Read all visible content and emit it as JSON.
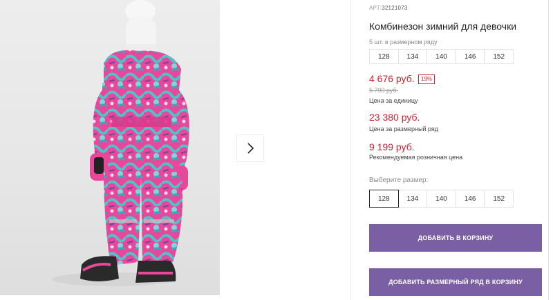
{
  "product": {
    "article_prefix": "АРТ:",
    "article_code": "32121073",
    "title": "Комбинезон зимний для девочки",
    "pack_hint": "5 шт. в размерном ряду",
    "pack_sizes": [
      "128",
      "134",
      "140",
      "146",
      "152"
    ],
    "price_unit": "4 676 руб.",
    "discount": "19%",
    "price_old": "5 790 руб.",
    "price_unit_label": "Цена за единицу",
    "price_row": "23 380 руб.",
    "price_row_label": "Цена за размерный ряд",
    "price_rrp": "9 199 руб.",
    "price_rrp_label": "Рекомендуемая розничная цена",
    "size_select_label": "Выберите размер:",
    "size_options": [
      "128",
      "134",
      "140",
      "146",
      "152"
    ],
    "selected_size": "128"
  },
  "actions": {
    "add_to_cart": "ДОБАВИТЬ В КОРЗИНУ",
    "add_row_to_cart": "ДОБАВИТЬ РАЗМЕРНЫЙ РЯД В КОРЗИНУ"
  },
  "gallery": {
    "next_icon": "chevron-right-icon"
  },
  "colors": {
    "accent_button": "#7a5fa5",
    "price_red": "#d2202f"
  }
}
